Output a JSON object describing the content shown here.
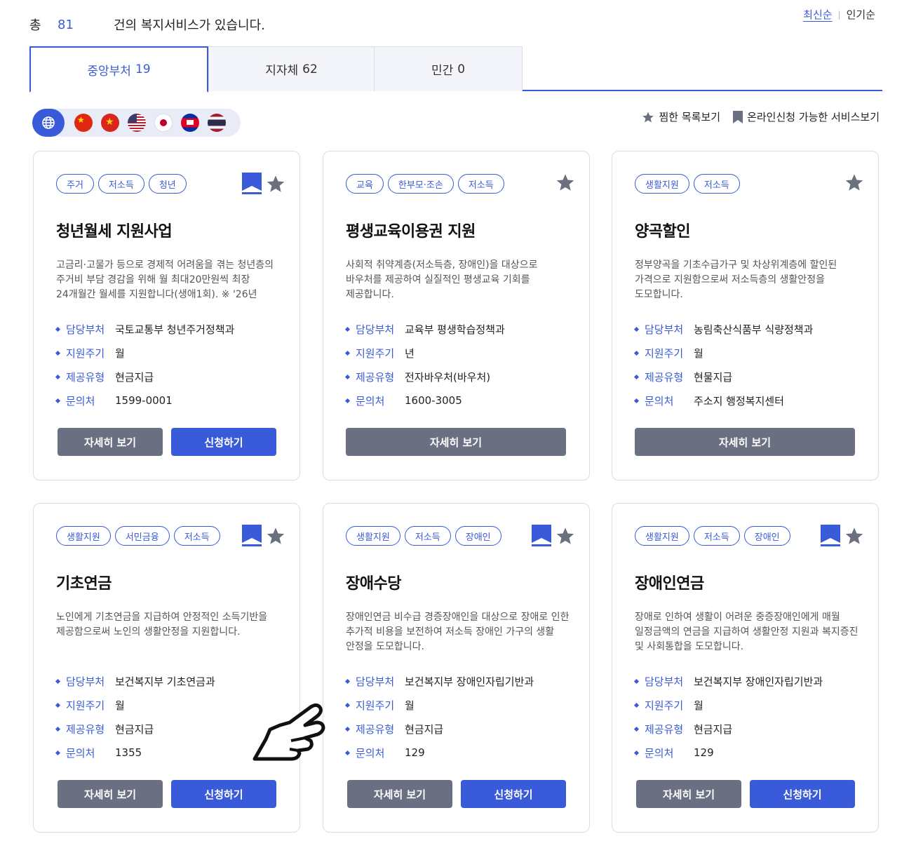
{
  "header": {
    "total_prefix": "총",
    "total_count": "81",
    "total_suffix": "건의 복지서비스가 있습니다.",
    "sort_latest": "최신순",
    "sort_popular": "인기순"
  },
  "tabs": [
    {
      "label": "중앙부처",
      "count": "19",
      "active": true
    },
    {
      "label": "지자체",
      "count": "62",
      "active": false
    },
    {
      "label": "민간",
      "count": "0",
      "active": false
    }
  ],
  "languages": [
    "globe-icon",
    "flag-china",
    "flag-vietnam",
    "flag-usa",
    "flag-japan",
    "flag-cambodia",
    "flag-thailand"
  ],
  "quicklinks": {
    "favorites": "찜한 목록보기",
    "online": "온라인신청 가능한 서비스보기"
  },
  "labels": {
    "dept": "담당부처",
    "cycle": "지원주기",
    "type": "제공유형",
    "contact": "문의처",
    "detail": "자세히 보기",
    "apply": "신청하기"
  },
  "cards": [
    {
      "tags": [
        "주거",
        "저소득",
        "청년"
      ],
      "title": "청년월세 지원사업",
      "desc": "고금리·고물가 등으로 경제적 어려움을 겪는 청년층의 주거비 부담 경감을 위해 월 최대20만원씩 최장 24개월간 월세를 지원합니다(생애1회). ※ '26년",
      "dept": "국토교통부 청년주거정책과",
      "cycle": "월",
      "type": "현금지급",
      "contact": "1599-0001"
    },
    {
      "tags": [
        "교육",
        "한부모·조손",
        "저소득"
      ],
      "title": "평생교육이용권 지원",
      "desc": "사회적 취약계층(저소득층, 장애인)을 대상으로 바우처를 제공하여 실질적인 평생교육 기회를 제공합니다.",
      "dept": "교육부 평생학습정책과",
      "cycle": "년",
      "type": "전자바우처(바우처)",
      "contact": "1600-3005"
    },
    {
      "tags": [
        "생활지원",
        "저소득"
      ],
      "title": "양곡할인",
      "desc": "정부양곡을 기초수급가구 및 차상위계층에 할인된 가격으로 지원함으로써 저소득층의 생활안정을 도모합니다.",
      "dept": "농림축산식품부 식량정책과",
      "cycle": "월",
      "type": "현물지급",
      "contact": "주소지 행정복지센터"
    },
    {
      "tags": [
        "생활지원",
        "서민금융",
        "저소득"
      ],
      "title": "기초연금",
      "desc": "노인에게 기초연금을 지급하여 안정적인 소득기반을 제공함으로써 노인의 생활안정을 지원합니다.",
      "dept": "보건복지부 기초연금과",
      "cycle": "월",
      "type": "현금지급",
      "contact": "1355"
    },
    {
      "tags": [
        "생활지원",
        "저소득",
        "장애인"
      ],
      "title": "장애수당",
      "desc": "장애인연금 비수급 경증장애인을 대상으로 장애로 인한 추가적 비용을 보전하여 저소득 장애인 가구의 생활 안정을 도모합니다.",
      "dept": "보건복지부 장애인자립기반과",
      "cycle": "월",
      "type": "현금지급",
      "contact": "129"
    },
    {
      "tags": [
        "생활지원",
        "저소득",
        "장애인"
      ],
      "title": "장애인연금",
      "desc": "장애로 인하여 생활이 어려운 중증장애인에게 매월 일정금액의 연금을 지급하여 생활안정 지원과 복지증진 및 사회통합을 도모합니다.",
      "dept": "보건복지부 장애인자립기반과",
      "cycle": "월",
      "type": "현금지급",
      "contact": "129"
    }
  ],
  "colors": {
    "accent": "#3a5bd9",
    "detail_button": "#6b6f82",
    "star": "#6b7080"
  }
}
